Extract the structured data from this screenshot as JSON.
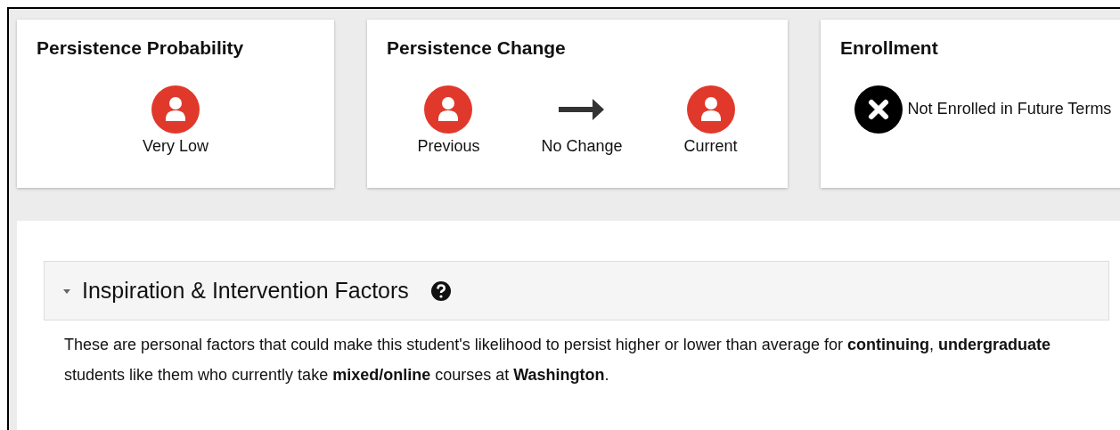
{
  "cards": [
    {
      "title": "Persistence Probability",
      "items": [
        {
          "kind": "person",
          "label": "Very Low"
        }
      ]
    },
    {
      "title": "Persistence Change",
      "items": [
        {
          "kind": "person",
          "label": "Previous"
        },
        {
          "kind": "arrow",
          "label": "No Change"
        },
        {
          "kind": "person",
          "label": "Current"
        }
      ]
    },
    {
      "title": "Enrollment",
      "items": [
        {
          "kind": "cross",
          "label": "Not Enrolled in Future Terms"
        }
      ]
    }
  ],
  "section": {
    "title": "Inspiration & Intervention Factors",
    "expanded": true,
    "description": "These are personal factors that could make this student's likelihood to persist higher or lower than average for **continuing**, **undergraduate** students like them who currently take **mixed/online** courses at **Washington**."
  }
}
